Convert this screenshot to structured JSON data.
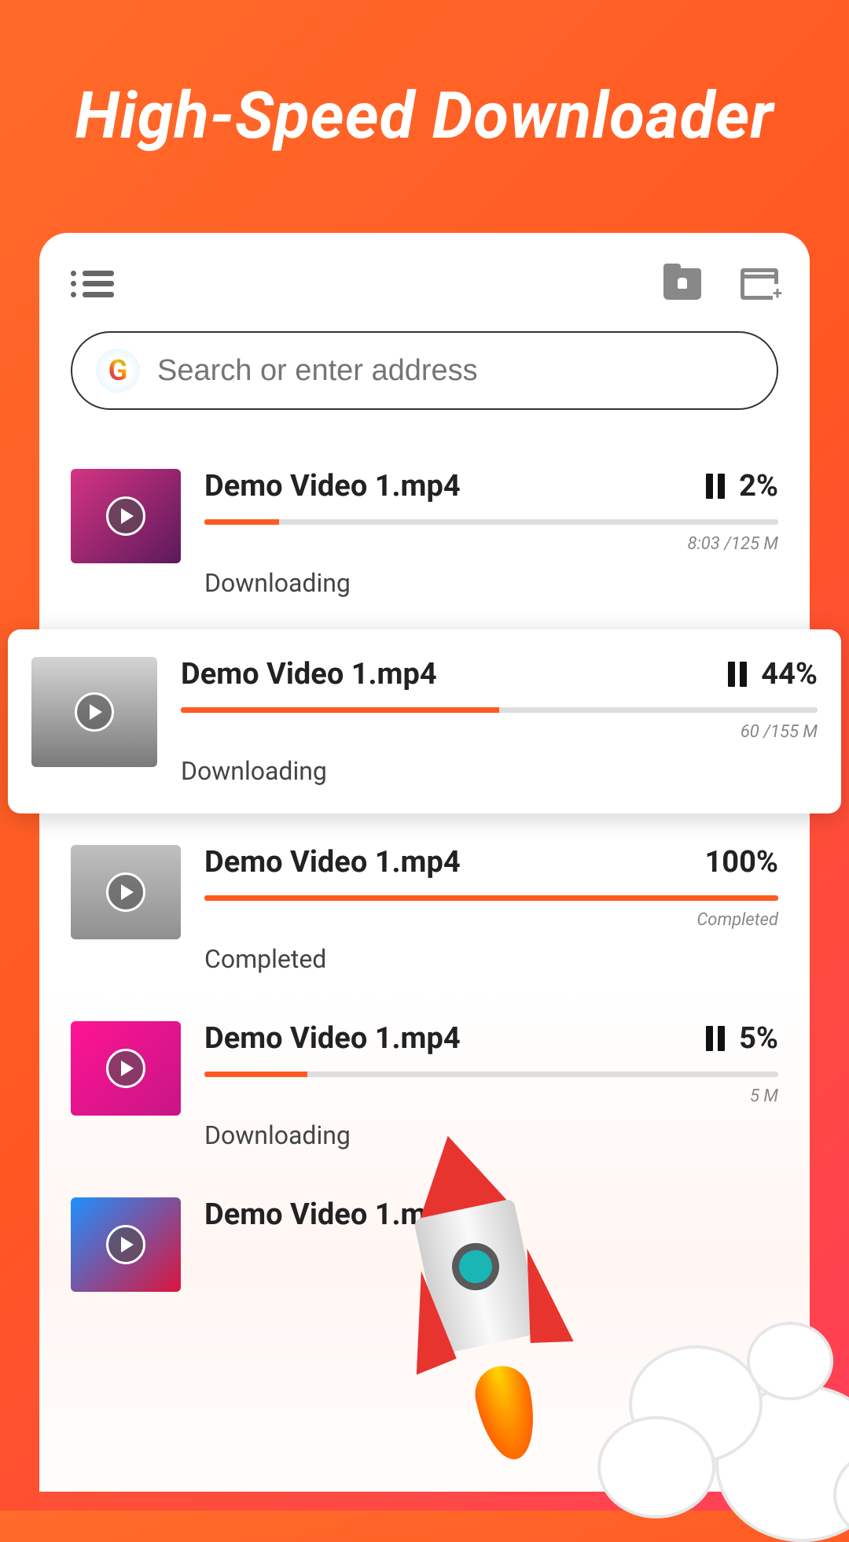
{
  "hero": {
    "title": "High-Speed Downloader"
  },
  "search": {
    "placeholder": "Search or enter address"
  },
  "downloads": [
    {
      "title": "Demo Video 1.mp4",
      "percent": "2%",
      "progress": 13,
      "size": "8:03 /125 M",
      "status": "Downloading",
      "show_pause": true
    },
    {
      "title": "Demo Video 1.mp4",
      "percent": "44%",
      "progress": 50,
      "size": "60 /155 M",
      "status": "Downloading",
      "show_pause": true
    },
    {
      "title": "Demo Video 1.mp4",
      "percent": "100%",
      "progress": 100,
      "size": "Completed",
      "status": "Completed",
      "show_pause": false
    },
    {
      "title": "Demo Video 1.mp4",
      "percent": "5%",
      "progress": 18,
      "size": "5 M",
      "status": "Downloading",
      "show_pause": true
    },
    {
      "title": "Demo Video 1.mp4",
      "percent": "",
      "progress": 0,
      "size": "",
      "status": "",
      "show_pause": false
    }
  ]
}
